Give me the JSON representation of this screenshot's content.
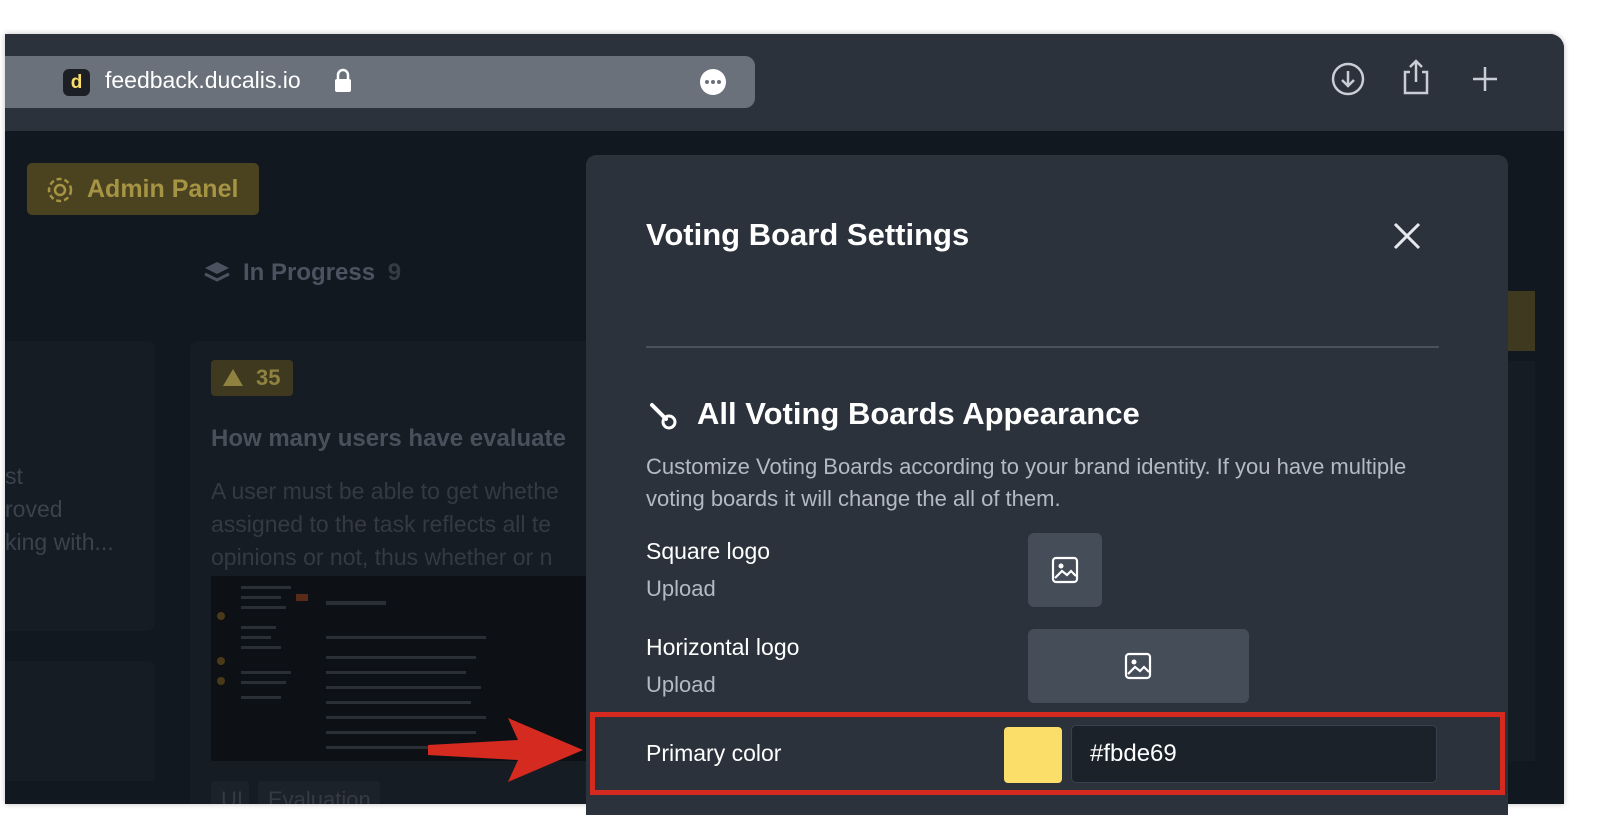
{
  "browser": {
    "url": "feedback.ducalis.io",
    "favicon_letter": "d"
  },
  "background": {
    "admin_panel_label": "Admin Panel",
    "column": {
      "title": "In Progress",
      "count": "9"
    },
    "left_card_lines": [
      "st",
      "roved",
      "king with..."
    ],
    "card": {
      "votes": "35",
      "title": "How many users have evaluate",
      "description_lines": [
        "A user must be able to get whethe",
        "assigned to the task reflects all te",
        "opinions or not, thus whether or n"
      ],
      "tags": [
        "UI",
        "Evaluation"
      ]
    }
  },
  "modal": {
    "title": "Voting Board Settings",
    "section_title": "All Voting Boards Appearance",
    "section_description": "Customize Voting Boards according to your brand identity. If you have multiple voting boards it will change the all of them.",
    "square_logo": {
      "label": "Square logo",
      "sub": "Upload"
    },
    "horizontal_logo": {
      "label": "Horizontal logo",
      "sub": "Upload"
    },
    "primary_color": {
      "label": "Primary color",
      "value": "#fbde69"
    }
  },
  "colors": {
    "accent": "#fbde69",
    "highlight": "#d42a1f",
    "modal_bg": "#2b323b"
  },
  "icons": [
    "lock-icon",
    "more-icon",
    "download-icon",
    "share-icon",
    "new-tab-icon",
    "gear-icon",
    "stack-icon",
    "close-icon",
    "brush-icon",
    "image-icon",
    "arrow-annotation"
  ]
}
